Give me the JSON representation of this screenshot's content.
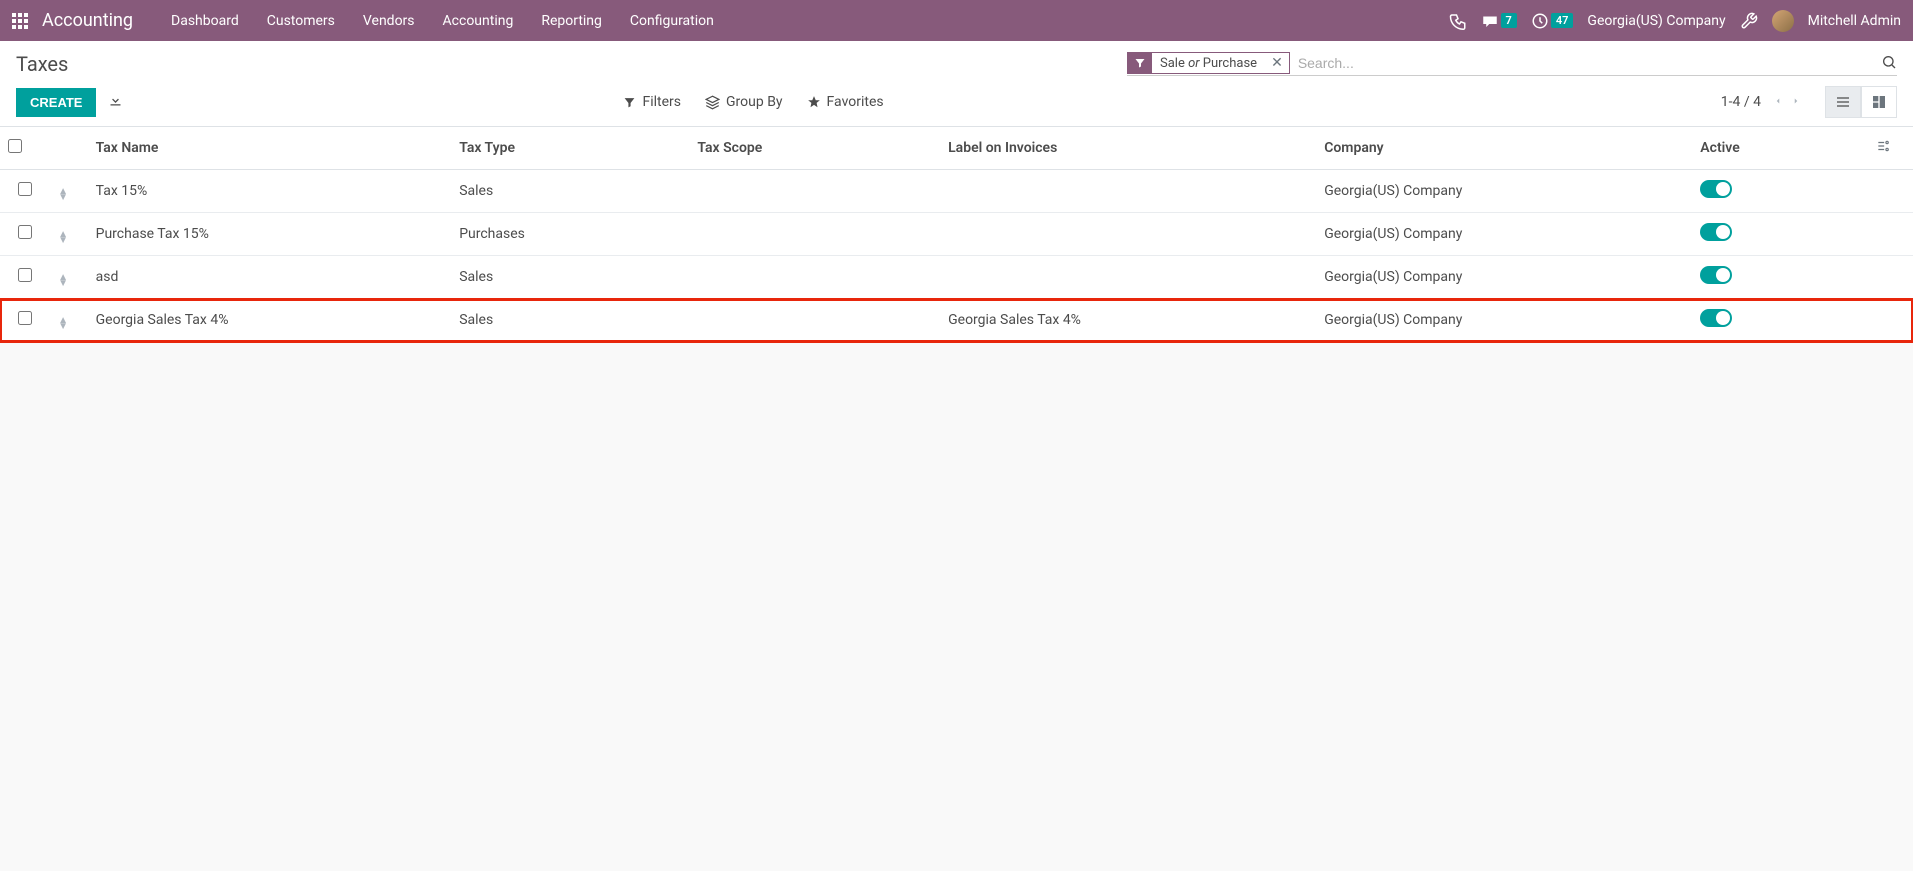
{
  "navbar": {
    "brand": "Accounting",
    "menu": [
      "Dashboard",
      "Customers",
      "Vendors",
      "Accounting",
      "Reporting",
      "Configuration"
    ],
    "messages_count": "7",
    "activities_count": "47",
    "company": "Georgia(US) Company",
    "user": "Mitchell Admin"
  },
  "breadcrumb": "Taxes",
  "search": {
    "facet_label_pre": "Sale ",
    "facet_label_or": "or",
    "facet_label_post": " Purchase",
    "placeholder": "Search..."
  },
  "buttons": {
    "create": "CREATE"
  },
  "filters": {
    "filters": "Filters",
    "groupby": "Group By",
    "favorites": "Favorites"
  },
  "pager": {
    "value": "1-4 / 4"
  },
  "columns": {
    "name": "Tax Name",
    "type": "Tax Type",
    "scope": "Tax Scope",
    "label": "Label on Invoices",
    "company": "Company",
    "active": "Active"
  },
  "rows": [
    {
      "name": "Tax 15%",
      "type": "Sales",
      "scope": "",
      "label": "",
      "company": "Georgia(US) Company",
      "active": true,
      "highlight": false
    },
    {
      "name": "Purchase Tax 15%",
      "type": "Purchases",
      "scope": "",
      "label": "",
      "company": "Georgia(US) Company",
      "active": true,
      "highlight": false
    },
    {
      "name": "asd",
      "type": "Sales",
      "scope": "",
      "label": "",
      "company": "Georgia(US) Company",
      "active": true,
      "highlight": false
    },
    {
      "name": "Georgia Sales Tax 4%",
      "type": "Sales",
      "scope": "",
      "label": "Georgia Sales Tax 4%",
      "company": "Georgia(US) Company",
      "active": true,
      "highlight": true
    }
  ]
}
